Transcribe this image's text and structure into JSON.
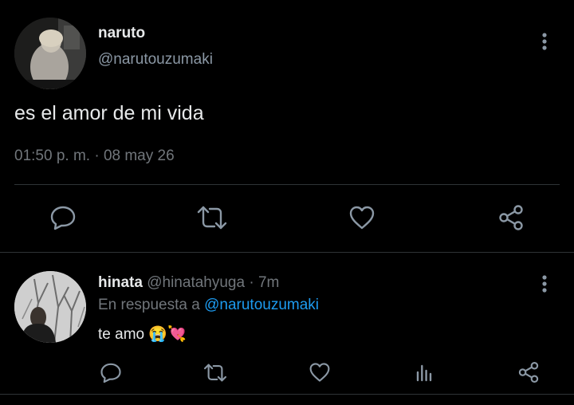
{
  "main_tweet": {
    "author_name": "naruto",
    "author_handle": "@narutouzumaki",
    "text": "es el amor de mi vida",
    "timestamp": "01:50 p. m. · 08 may 26",
    "actions": [
      "reply-icon",
      "retweet-icon",
      "like-icon",
      "share-icon"
    ]
  },
  "reply": {
    "author_name": "hinata",
    "author_handle": "@hinatahyuga",
    "separator": " · ",
    "time_ago": "7m",
    "reply_to_prefix": "En respuesta a ",
    "reply_to_handle": "@narutouzumaki",
    "text": "te amo",
    "emojis": "😭💘",
    "actions": [
      "reply-icon",
      "retweet-icon",
      "like-icon",
      "analytics-icon",
      "share-icon"
    ]
  },
  "colors": {
    "background": "#000000",
    "text": "#e7e9ea",
    "secondary": "#71767b",
    "icon": "#8b98a5",
    "link": "#1d9bf0",
    "divider": "#2f3336"
  }
}
